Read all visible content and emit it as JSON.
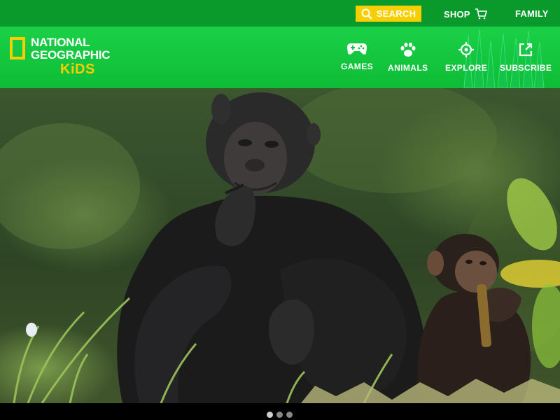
{
  "topbar": {
    "search_label": "SEARCH",
    "shop_label": "SHOP",
    "family_label": "FAMILY"
  },
  "logo": {
    "line1": "NATIONAL",
    "line2": "GEOGRAPHIC",
    "kids": "KiDS"
  },
  "nav": {
    "items": [
      {
        "label": "GAMES",
        "icon": "gamepad-icon"
      },
      {
        "label": "ANIMALS",
        "icon": "paw-icon"
      },
      {
        "label": "EXPLORE",
        "icon": "target-icon"
      },
      {
        "label": "SUBSCRIBE",
        "icon": "external-link-icon"
      }
    ]
  },
  "carousel": {
    "active_index": 0,
    "slide_count": 3
  },
  "colors": {
    "topbar": "#0a9a2c",
    "navbar": "#1bd048",
    "accent_yellow": "#f7cf00"
  }
}
